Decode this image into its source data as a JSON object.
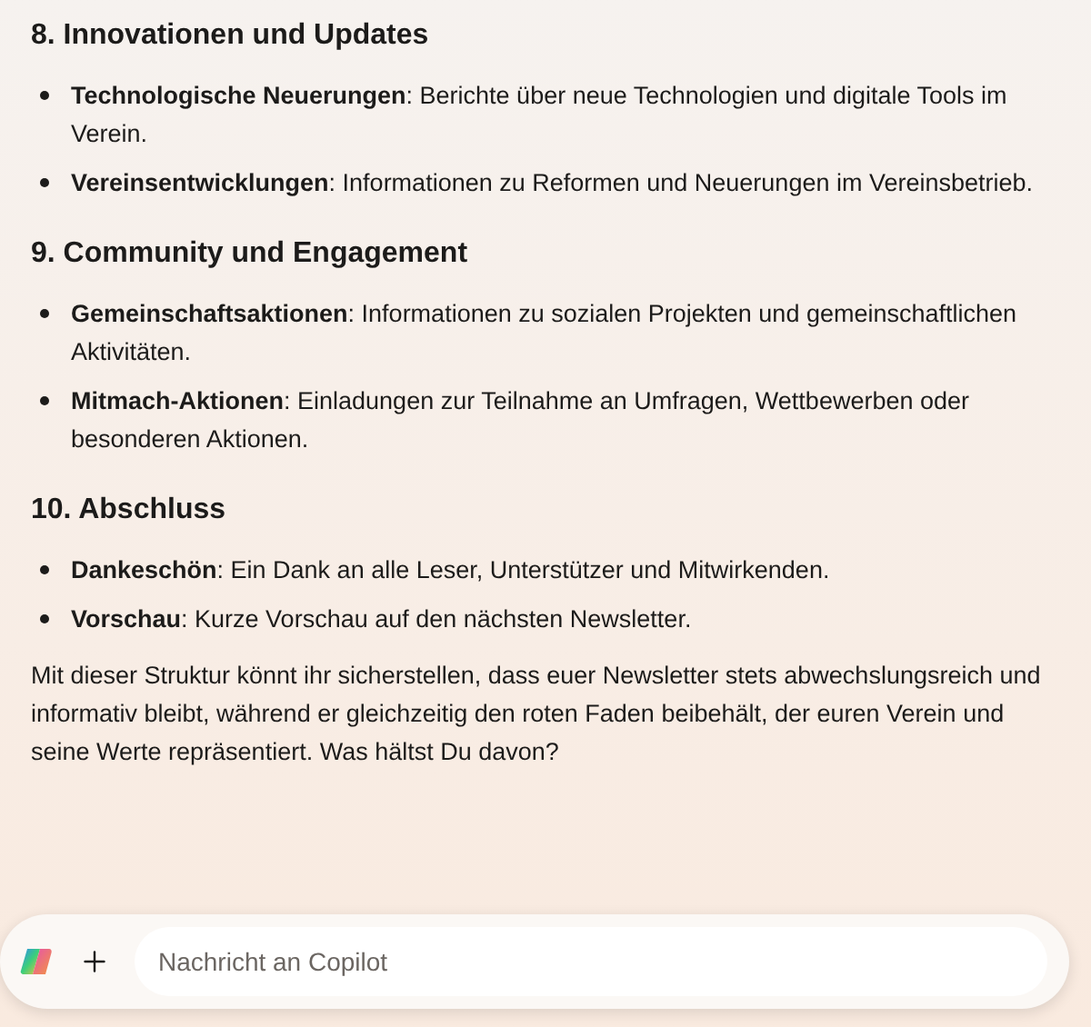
{
  "sections": [
    {
      "heading": "8. Innovationen und Updates",
      "items": [
        "**Technologische Neuerungen**: Berichte über neue Technologien und digitale Tools im Verein.",
        "**Vereinsentwicklungen**: Informationen zu Reformen und Neuerungen im Vereinsbetrieb."
      ]
    },
    {
      "heading": "9. Community und Engagement",
      "items": [
        "**Gemeinschaftsaktionen**: Informationen zu sozialen Projekten und gemeinschaftlichen Aktivitäten.",
        "**Mitmach-Aktionen**: Einladungen zur Teilnahme an Umfragen, Wettbewerben oder besonderen Aktionen."
      ]
    },
    {
      "heading": "10. Abschluss",
      "items": [
        "**Dankeschön**: Ein Dank an alle Leser, Unterstützer und Mitwirkenden.",
        "**Vorschau**: Kurze Vorschau auf den nächsten Newsletter."
      ]
    }
  ],
  "closing": "Mit dieser Struktur könnt ihr sicherstellen, dass euer Newsletter stets abwechslungsreich und informativ bleibt, während er gleichzeitig den roten Faden beibehält, der euren Verein und seine Werte repräsentiert. Was hältst Du davon?",
  "composer": {
    "placeholder": "Nachricht an Copilot"
  }
}
